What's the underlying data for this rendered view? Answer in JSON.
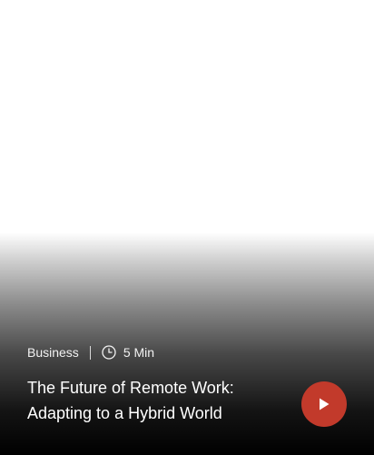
{
  "card": {
    "category": "Business",
    "read_time": "5 Min",
    "title_line1": "The Future of Remote Work:",
    "title_line2": "Adapting to a Hybrid World",
    "icons": {
      "clock": "clock-icon",
      "play": "play-icon"
    },
    "colors": {
      "accent": "#c23a2b",
      "text": "#ffffff"
    }
  }
}
